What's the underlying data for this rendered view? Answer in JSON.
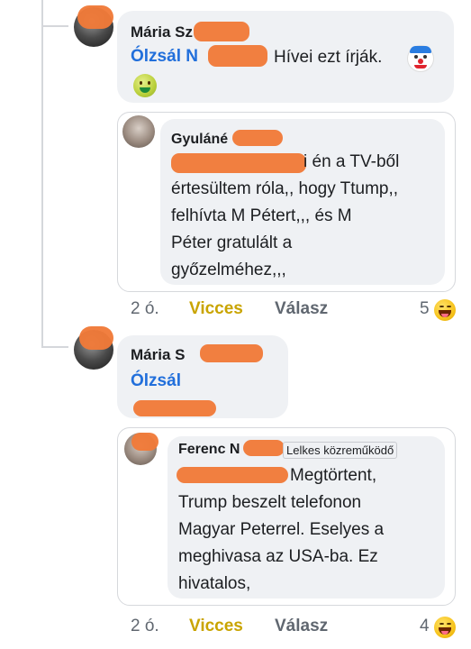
{
  "comments": [
    {
      "author": "Mária Sz",
      "mention": "Ólzsál N",
      "text": "Hívei ezt írják.",
      "emoji_end": "clown-face",
      "emoji_second_line": "nauseated-face",
      "quote": {
        "author": "Gyuláné",
        "lines": [
          "i én a TV-ből",
          "értesültem róla,, hogy Ttump,,",
          "felhívta M Pétert,,, és M",
          "Péter gratulált a",
          "győzelméhez,,,"
        ]
      },
      "meta": {
        "time": "2 ó.",
        "reaction_label": "Vicces",
        "reply_label": "Válasz",
        "reaction_count": "5",
        "reaction_icon": "laughing-face"
      }
    },
    {
      "author": "Mária S",
      "mention": "Ólzsál",
      "quote": {
        "author": "Ferenc N",
        "badge": "Lelkes közreműködő",
        "lines": [
          "Megtörtent,",
          "Trump beszelt telefonon",
          "Magyar Peterrel. Eselyes a",
          "meghivasa az USA-ba. Ez",
          "hivatalos,"
        ]
      },
      "meta": {
        "time": "2 ó.",
        "reaction_label": "Vicces",
        "reply_label": "Válasz",
        "reaction_count": "4",
        "reaction_icon": "laughing-face"
      }
    }
  ]
}
